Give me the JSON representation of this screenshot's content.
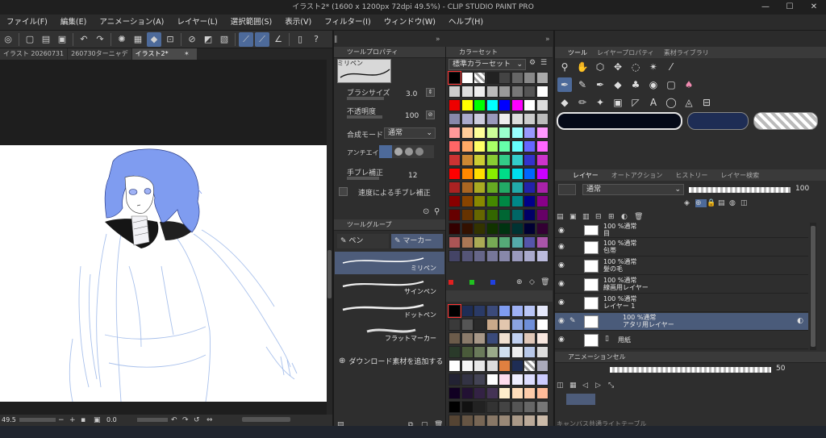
{
  "window": {
    "title": "イラスト2* (1600 x 1200px 72dpi 49.5%)  - CLIP STUDIO PAINT PRO"
  },
  "menu": [
    "ファイル(F)",
    "編集(E)",
    "アニメーション(A)",
    "レイヤー(L)",
    "選択範囲(S)",
    "表示(V)",
    "フィルター(I)",
    "ウィンドウ(W)",
    "ヘルプ(H)"
  ],
  "tabs": [
    {
      "label": "イラスト 20260731"
    },
    {
      "label": "260730ターニャデ"
    },
    {
      "label": "イラスト2*"
    }
  ],
  "canvas": {
    "zoom": "49.5",
    "rotation": "0.0"
  },
  "tool_property": {
    "header": "ツールプロパティ",
    "brush_name": "ミリペン",
    "brush_size_label": "ブラシサイズ",
    "brush_size_value": "3.0",
    "opacity_label": "不透明度",
    "opacity_value": "100",
    "blend_label": "合成モード",
    "blend_value": "通常",
    "antialias_label": "アンチエイリアス",
    "stabilization_label": "手ブレ補正",
    "stabilization_value": "12",
    "speed_stab_label": "速度による手ブレ補正"
  },
  "tool_group": {
    "header": "ツールグループ",
    "tabs": [
      "ペン",
      "マーカー"
    ],
    "items": [
      "ミリペン",
      "サインペン",
      "ドットペン",
      "フラットマーカー"
    ],
    "download": "ダウンロード素材を追加する"
  },
  "color_set": {
    "header": "カラーセット",
    "preset": "標準カラーセット"
  },
  "tool_panel": {
    "tabs": [
      "ツール",
      "レイヤープロパティ",
      "素材ライブラリ"
    ]
  },
  "layer_panel": {
    "tabs": [
      "レイヤー",
      "オートアクション",
      "ヒストリー",
      "レイヤー検索"
    ],
    "blend": "通常",
    "opacity": "100",
    "layers": [
      {
        "opacity": "100 %通常",
        "name": "目"
      },
      {
        "opacity": "100 %通常",
        "name": "包帯"
      },
      {
        "opacity": "100 %通常",
        "name": "髪の毛"
      },
      {
        "opacity": "100 %通常",
        "name": "線画用レイヤー"
      },
      {
        "opacity": "100 %通常",
        "name": "レイヤー 1"
      },
      {
        "opacity": "100 %通常",
        "name": "アタリ用レイヤー"
      },
      {
        "opacity": "",
        "name": "用紙"
      }
    ]
  },
  "animation_panel": {
    "header": "アニメーションセル",
    "value": "50"
  },
  "bottom_label": "キャンバス共通ライトテーブル",
  "colors": {
    "accent": "#4d6a9a",
    "panel": "#2e2e2e",
    "sketch_blue": "#6e8de0"
  }
}
